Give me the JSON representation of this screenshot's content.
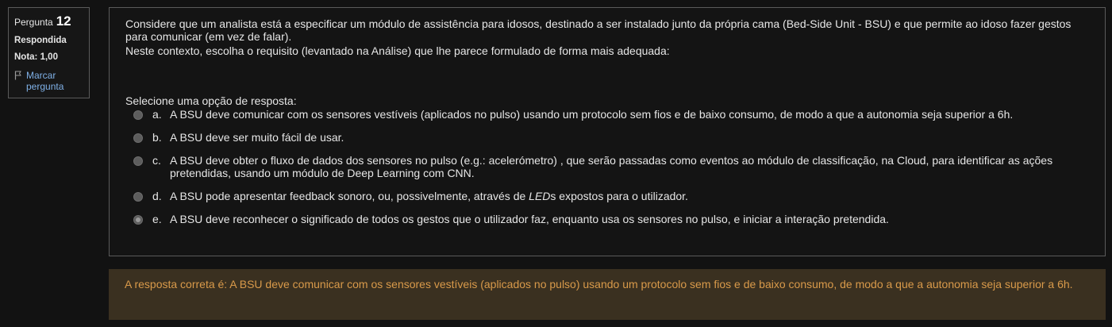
{
  "info": {
    "question_label": "Pergunta",
    "question_number": "12",
    "state": "Respondida",
    "grade": "Nota: 1,00",
    "flag_label": "Marcar pergunta"
  },
  "question": {
    "text_line1": "Considere que um analista está a especificar um módulo de assistência para idosos, destinado a ser instalado junto da própria cama (Bed-Side Unit - BSU) e que permite ao idoso fazer gestos para comunicar (em vez de falar).",
    "text_line2": "Neste contexto, escolha o requisito (levantado na Análise) que lhe parece formulado de forma mais adequada:",
    "prompt": "Selecione uma opção de resposta:",
    "options": [
      {
        "letter": "a.",
        "text": "A BSU deve comunicar com os sensores vestíveis (aplicados no pulso) usando um protocolo sem fios e de baixo consumo, de modo a que a autonomia seja superior a 6h."
      },
      {
        "letter": "b.",
        "text": "A BSU deve ser muito fácil de usar."
      },
      {
        "letter": "c.",
        "text": "A BSU deve obter o fluxo de dados dos sensores no pulso (e.g.: acelerómetro) , que serão passadas como eventos ao módulo de classificação, na Cloud, para identificar as ações pretendidas, usando um módulo de Deep Learning com CNN."
      },
      {
        "letter": "d.",
        "text_before": "A BSU pode apresentar feedback sonoro, ou, possivelmente, através de ",
        "text_em": "LED",
        "text_after": "s expostos para o utilizador."
      },
      {
        "letter": "e.",
        "text": "A BSU deve reconhecer o significado de todos os gestos que o utilizador faz, enquanto usa os sensores no pulso, e iniciar a interação pretendida."
      }
    ],
    "selected_option": "e."
  },
  "feedback": {
    "text": "A resposta correta é: A BSU deve comunicar com os sensores vestíveis (aplicados no pulso) usando um protocolo sem fios e de baixo consumo, de modo a que a autonomia seja superior a 6h."
  }
}
